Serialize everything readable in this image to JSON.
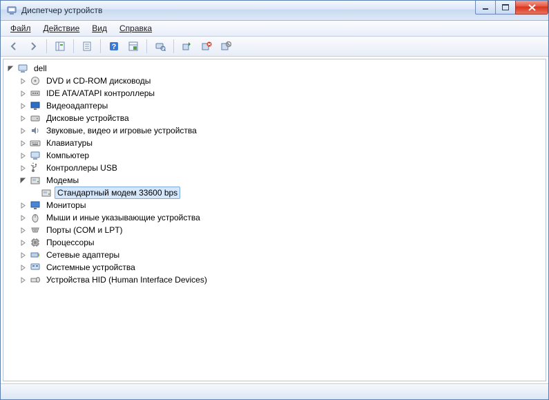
{
  "window": {
    "title": "Диспетчер устройств"
  },
  "menu": {
    "file": "Файл",
    "action": "Действие",
    "view": "Вид",
    "help": "Справка"
  },
  "tree": {
    "root": "dell",
    "dvd": "DVD и CD-ROM дисководы",
    "ide": "IDE ATA/ATAPI контроллеры",
    "video": "Видеоадаптеры",
    "disk": "Дисковые устройства",
    "sound": "Звуковые, видео и игровые устройства",
    "keyboard": "Клавиатуры",
    "computer": "Компьютер",
    "usb": "Контроллеры USB",
    "modems": "Модемы",
    "modem_std": "Стандартный модем 33600 bps",
    "monitors": "Мониторы",
    "mice": "Мыши и иные указывающие устройства",
    "ports": "Порты (COM и LPT)",
    "cpu": "Процессоры",
    "netadapters": "Сетевые адаптеры",
    "sysdevices": "Системные устройства",
    "hid": "Устройства HID (Human Interface Devices)"
  }
}
